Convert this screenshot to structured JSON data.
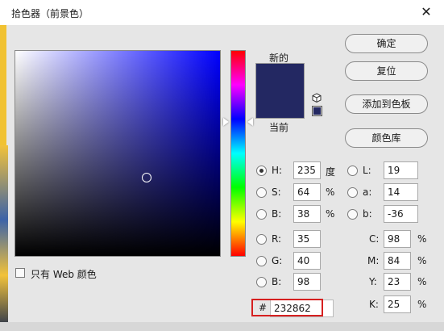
{
  "window": {
    "title": "拾色器（前景色）"
  },
  "labels": {
    "new": "新的",
    "current": "当前"
  },
  "buttons": {
    "ok": "确定",
    "reset": "复位",
    "add_swatch": "添加到色板",
    "libraries": "颜色库"
  },
  "web_only": {
    "label": "只有 Web 颜色",
    "checked": false
  },
  "color": {
    "hex": "232862",
    "hsb": {
      "h": "235",
      "s": "64",
      "b": "38"
    },
    "rgb": {
      "r": "35",
      "g": "40",
      "b": "98"
    },
    "lab": {
      "l": "19",
      "a": "14",
      "b": "-36"
    },
    "cmyk": {
      "c": "98",
      "m": "84",
      "y": "23",
      "k": "25"
    }
  },
  "field_labels": {
    "h": "H:",
    "s": "S:",
    "b_hsb": "B:",
    "r": "R:",
    "g": "G:",
    "b_rgb": "B:",
    "l": "L:",
    "a": "a:",
    "b_lab": "b:",
    "c": "C:",
    "m": "M:",
    "y": "Y:",
    "k": "K:",
    "hash": "#"
  },
  "units": {
    "degree": "度",
    "percent": "%"
  },
  "selected_mode": "H",
  "colors": {
    "swatch_new": "#232862",
    "swatch_current": "#232862",
    "hex_highlight_border": "#d62020"
  },
  "icons": {
    "close": "close-icon",
    "cube": "3d-cube-icon",
    "websafe": "web-safe-swatch-icon"
  }
}
